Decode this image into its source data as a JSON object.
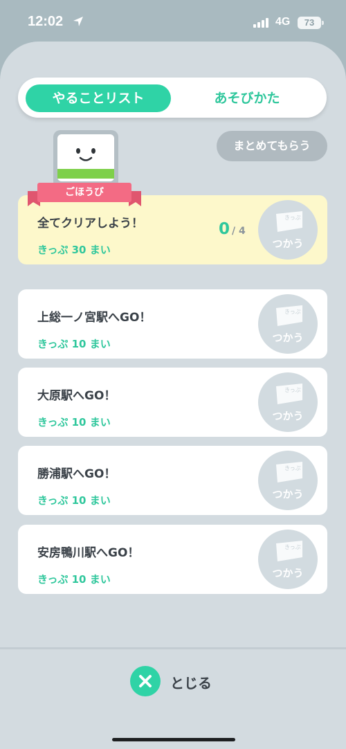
{
  "status": {
    "time": "12:02",
    "network": "4G",
    "battery": "73"
  },
  "tabs": [
    {
      "label": "やることリスト",
      "active": true
    },
    {
      "label": "あそびかた",
      "active": false
    }
  ],
  "collect_button": "まとめてもらう",
  "reward": {
    "badge": "ごほうび",
    "title": "全てクリアしよう！",
    "tickets": "きっぷ 30 まい",
    "progress_current": "0",
    "progress_total": "/ 4",
    "ticket_icon_text": "きっぷ",
    "use_label": "つかう"
  },
  "missions": [
    {
      "title": "上総一ノ宮駅へGO！",
      "tickets": "きっぷ 10 まい",
      "ticket_icon_text": "きっぷ",
      "use_label": "つかう"
    },
    {
      "title": "大原駅へGO！",
      "tickets": "きっぷ 10 まい",
      "ticket_icon_text": "きっぷ",
      "use_label": "つかう"
    },
    {
      "title": "勝浦駅へGO！",
      "tickets": "きっぷ 10 まい",
      "ticket_icon_text": "きっぷ",
      "use_label": "つかう"
    },
    {
      "title": "安房鴨川駅へGO！",
      "tickets": "きっぷ 10 まい",
      "ticket_icon_text": "きっぷ",
      "use_label": "つかう"
    }
  ],
  "close_label": "とじる",
  "colors": {
    "accent": "#2fd3a6",
    "reward_card": "#fdf8cb",
    "ribbon": "#f36b84",
    "background": "#d3dbe0"
  }
}
